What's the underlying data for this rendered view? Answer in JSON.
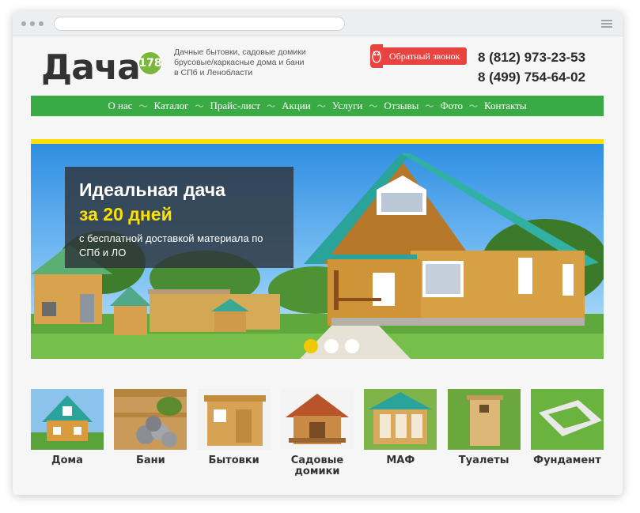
{
  "brand": {
    "name": "Дача",
    "badge": "178",
    "tagline": "Дачные бытовки, садовые домики брусовые/каркасные дома и бани в СПб и Ленобласти"
  },
  "header": {
    "callback_label": "Обратный звонок",
    "phones": [
      "8 (812) 973-23-53",
      "8 (499) 754-64-02"
    ]
  },
  "nav": {
    "items": [
      "О нас",
      "Каталог",
      "Прайс-лист",
      "Акции",
      "Услуги",
      "Отзывы",
      "Фото",
      "Контакты"
    ]
  },
  "slider": {
    "title": "Идеальная дача",
    "accent": "за 20 дней",
    "subtitle": "с бесплатной доставкой материала по СПб и ЛО",
    "dots": 3,
    "active_dot": 0
  },
  "categories": [
    {
      "label": "Дома"
    },
    {
      "label": "Бани"
    },
    {
      "label": "Бытовки"
    },
    {
      "label": "Садовые домики"
    },
    {
      "label": "МАФ"
    },
    {
      "label": "Туалеты"
    },
    {
      "label": "Фундамент"
    }
  ],
  "colors": {
    "nav_green": "#3aaa45",
    "accent_yellow": "#ffe000",
    "callback_red": "#e8433f"
  }
}
